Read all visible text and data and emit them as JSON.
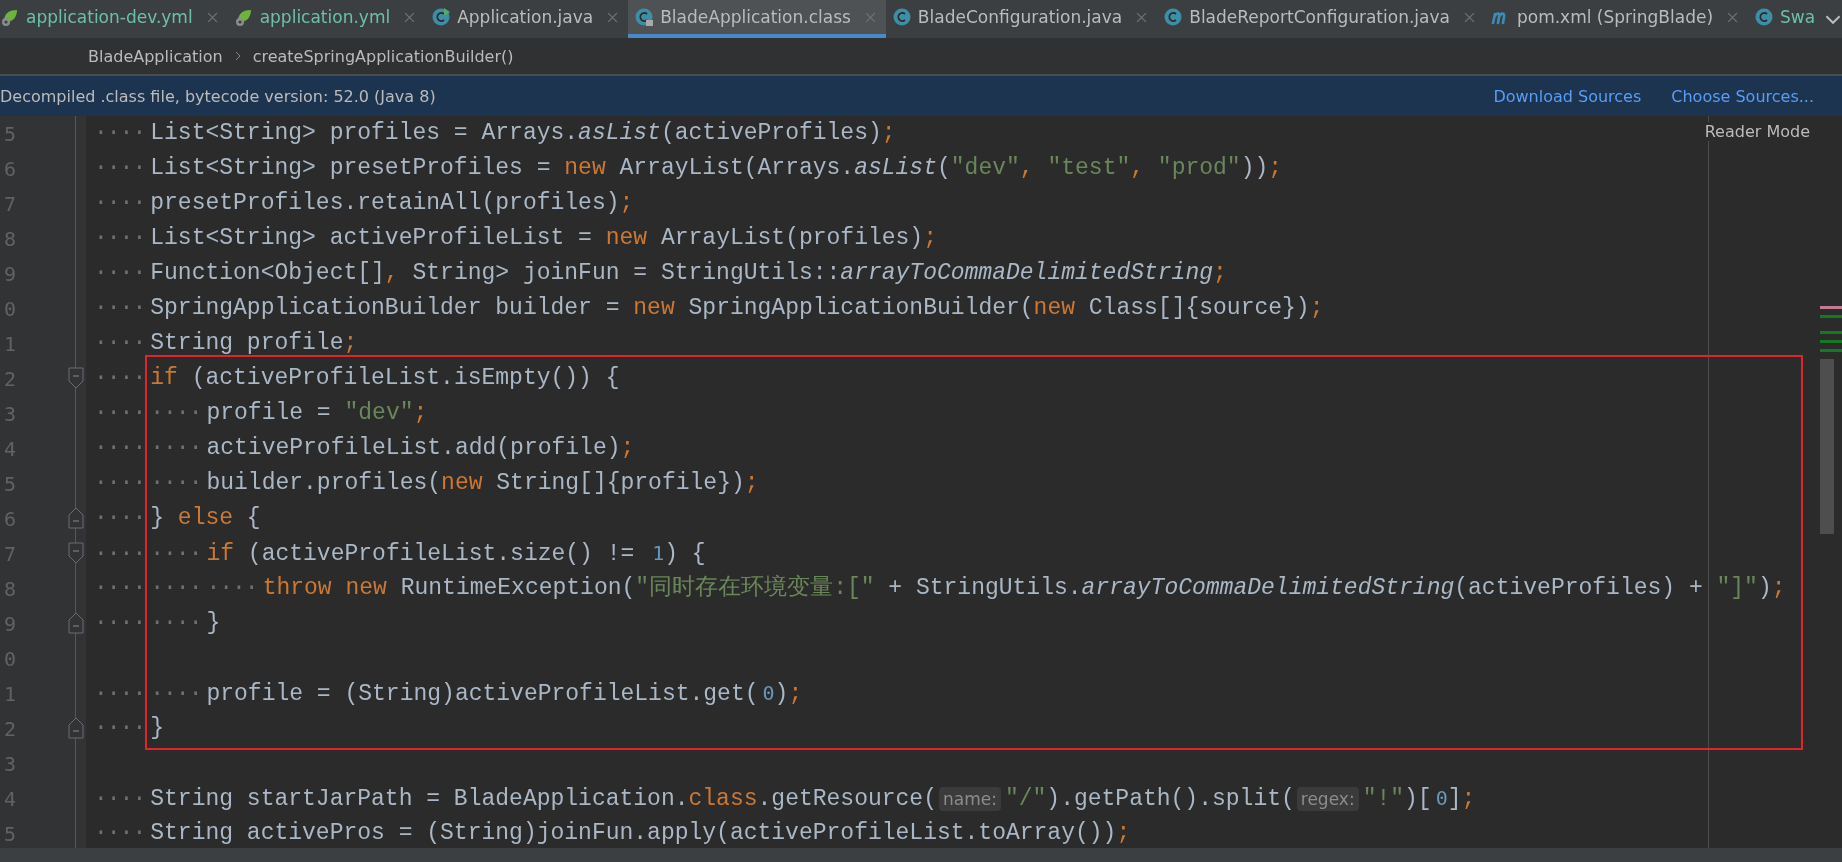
{
  "tabs": [
    {
      "label": "application-dev.yml",
      "kind": "spring",
      "color": "#6cc0a8",
      "selected": false
    },
    {
      "label": "application.yml",
      "kind": "spring",
      "color": "#6cc0a8",
      "selected": false
    },
    {
      "label": "Application.java",
      "kind": "class-run",
      "color": "#bbbbbb",
      "selected": false
    },
    {
      "label": "BladeApplication.class",
      "kind": "class-locked",
      "color": "#bbbbbb",
      "selected": true
    },
    {
      "label": "BladeConfiguration.java",
      "kind": "class",
      "color": "#bbbbbb",
      "selected": false
    },
    {
      "label": "BladeReportConfiguration.java",
      "kind": "class",
      "color": "#bbbbbb",
      "selected": false
    },
    {
      "label": "pom.xml (SpringBlade)",
      "kind": "maven",
      "color": "#bbbbbb",
      "selected": false
    },
    {
      "label": "Swa",
      "kind": "class",
      "color": "#6cc0a8",
      "selected": false,
      "cut": true
    }
  ],
  "breadcrumbs": [
    "BladeApplication",
    "createSpringApplicationBuilder()"
  ],
  "banner": {
    "message": "Decompiled .class file, bytecode version: 52.0 (Java 8)",
    "links": [
      "Download Sources",
      "Choose Sources..."
    ]
  },
  "reader_mode": "Reader Mode",
  "code_blocks": [
    {
      "framed": false,
      "lines": [
        {
          "number": "5",
          "tokens": [
            {
              "kind": "ws",
              "text": "····"
            },
            {
              "kind": "plain",
              "text": "List<String> profiles = Arrays."
            },
            {
              "kind": "italic",
              "text": "asList"
            },
            {
              "kind": "plain",
              "text": "(activeProfiles)"
            },
            {
              "kind": "kw",
              "text": ";"
            }
          ]
        },
        {
          "number": "6",
          "tokens": [
            {
              "kind": "ws",
              "text": "····"
            },
            {
              "kind": "plain",
              "text": "List<String> presetProfiles = "
            },
            {
              "kind": "kw",
              "text": "new "
            },
            {
              "kind": "plain",
              "text": "ArrayList(Arrays."
            },
            {
              "kind": "italic",
              "text": "asList"
            },
            {
              "kind": "plain",
              "text": "("
            },
            {
              "kind": "str",
              "text": "\"dev\""
            },
            {
              "kind": "kw",
              "text": ", "
            },
            {
              "kind": "str",
              "text": "\"test\""
            },
            {
              "kind": "kw",
              "text": ", "
            },
            {
              "kind": "str",
              "text": "\"prod\""
            },
            {
              "kind": "plain",
              "text": "))"
            },
            {
              "kind": "kw",
              "text": ";"
            }
          ]
        },
        {
          "number": "7",
          "tokens": [
            {
              "kind": "ws",
              "text": "····"
            },
            {
              "kind": "plain",
              "text": "presetProfiles.retainAll(profiles)"
            },
            {
              "kind": "kw",
              "text": ";"
            }
          ]
        },
        {
          "number": "8",
          "tokens": [
            {
              "kind": "ws",
              "text": "····"
            },
            {
              "kind": "plain",
              "text": "List<String> activeProfileList = "
            },
            {
              "kind": "kw",
              "text": "new "
            },
            {
              "kind": "plain",
              "text": "ArrayList(profiles)"
            },
            {
              "kind": "kw",
              "text": ";"
            }
          ]
        },
        {
          "number": "9",
          "tokens": [
            {
              "kind": "ws",
              "text": "····"
            },
            {
              "kind": "plain",
              "text": "Function<Object[]"
            },
            {
              "kind": "kw",
              "text": ", "
            },
            {
              "kind": "plain",
              "text": "String> joinFun = StringUtils::"
            },
            {
              "kind": "italic",
              "text": "arrayToCommaDelimitedString"
            },
            {
              "kind": "kw",
              "text": ";"
            }
          ]
        },
        {
          "number": "0",
          "tokens": [
            {
              "kind": "ws",
              "text": "····"
            },
            {
              "kind": "plain",
              "text": "SpringApplicationBuilder builder = "
            },
            {
              "kind": "kw",
              "text": "new "
            },
            {
              "kind": "plain",
              "text": "SpringApplicationBuilder("
            },
            {
              "kind": "kw",
              "text": "new "
            },
            {
              "kind": "plain",
              "text": "Class[]{source})"
            },
            {
              "kind": "kw",
              "text": ";"
            }
          ]
        },
        {
          "number": "1",
          "tokens": [
            {
              "kind": "ws",
              "text": "····"
            },
            {
              "kind": "plain",
              "text": "String profile"
            },
            {
              "kind": "kw",
              "text": ";"
            }
          ]
        }
      ]
    },
    {
      "framed": true,
      "lines": [
        {
          "number": "2",
          "kind": "fold-start",
          "tokens": [
            {
              "kind": "ws",
              "text": "····"
            },
            {
              "kind": "kw",
              "text": "if "
            },
            {
              "kind": "plain",
              "text": "(activeProfileList.isEmpty()) {"
            }
          ]
        },
        {
          "number": "3",
          "tokens": [
            {
              "kind": "ws",
              "text": "····"
            },
            {
              "kind": "ws",
              "text": "····"
            },
            {
              "kind": "plain",
              "text": "profile = "
            },
            {
              "kind": "str",
              "text": "\"dev\""
            },
            {
              "kind": "kw",
              "text": ";"
            }
          ]
        },
        {
          "number": "4",
          "tokens": [
            {
              "kind": "ws",
              "text": "····"
            },
            {
              "kind": "ws",
              "text": "····"
            },
            {
              "kind": "plain",
              "text": "activeProfileList.add(profile)"
            },
            {
              "kind": "kw",
              "text": ";"
            }
          ]
        },
        {
          "number": "5",
          "tokens": [
            {
              "kind": "ws",
              "text": "····"
            },
            {
              "kind": "ws",
              "text": "····"
            },
            {
              "kind": "plain",
              "text": "builder.profiles("
            },
            {
              "kind": "kw",
              "text": "new "
            },
            {
              "kind": "plain",
              "text": "String[]{profile})"
            },
            {
              "kind": "kw",
              "text": ";"
            }
          ]
        },
        {
          "number": "6",
          "kind": "fold-end",
          "tokens": [
            {
              "kind": "ws",
              "text": "····"
            },
            {
              "kind": "plain",
              "text": "} "
            },
            {
              "kind": "kw",
              "text": "else "
            },
            {
              "kind": "plain",
              "text": "{"
            }
          ]
        },
        {
          "number": "7",
          "kind": "fold-start",
          "tokens": [
            {
              "kind": "ws",
              "text": "····"
            },
            {
              "kind": "ws",
              "text": "····"
            },
            {
              "kind": "kw",
              "text": "if "
            },
            {
              "kind": "plain",
              "text": "(activeProfileList.size() != "
            },
            {
              "kind": "num",
              "text": "1"
            },
            {
              "kind": "plain",
              "text": ") {"
            }
          ]
        },
        {
          "number": "8",
          "tokens": [
            {
              "kind": "ws",
              "text": "····"
            },
            {
              "kind": "ws",
              "text": "····"
            },
            {
              "kind": "ws",
              "text": "····"
            },
            {
              "kind": "kw",
              "text": "throw new "
            },
            {
              "kind": "plain",
              "text": "RuntimeException("
            },
            {
              "kind": "str",
              "text": "\"同时存在环境变量:[\""
            },
            {
              "kind": "plain",
              "text": " + StringUtils."
            },
            {
              "kind": "italic",
              "text": "arrayToCommaDelimitedString"
            },
            {
              "kind": "plain",
              "text": "(activeProfiles) + "
            },
            {
              "kind": "str",
              "text": "\"]\""
            },
            {
              "kind": "plain",
              "text": ")"
            },
            {
              "kind": "kw",
              "text": ";"
            }
          ]
        },
        {
          "number": "9",
          "kind": "fold-end",
          "tokens": [
            {
              "kind": "ws",
              "text": "····"
            },
            {
              "kind": "ws",
              "text": "····"
            },
            {
              "kind": "plain",
              "text": "}"
            }
          ]
        },
        {
          "number": "0"
        },
        {
          "number": "1",
          "tokens": [
            {
              "kind": "ws",
              "text": "····"
            },
            {
              "kind": "ws",
              "text": "····"
            },
            {
              "kind": "plain",
              "text": "profile = (String)activeProfileList.get("
            },
            {
              "kind": "num",
              "text": "0"
            },
            {
              "kind": "plain",
              "text": ")"
            },
            {
              "kind": "kw",
              "text": ";"
            }
          ]
        },
        {
          "number": "2",
          "kind": "fold-end",
          "tokens": [
            {
              "kind": "ws",
              "text": "····"
            },
            {
              "kind": "plain",
              "text": "}"
            }
          ]
        }
      ]
    },
    {
      "framed": false,
      "lines": [
        {
          "number": "3"
        },
        {
          "number": "4",
          "tokens": [
            {
              "kind": "ws",
              "text": "····"
            },
            {
              "kind": "plain",
              "text": "String startJarPath = BladeApplication."
            },
            {
              "kind": "kw",
              "text": "class"
            },
            {
              "kind": "plain",
              "text": ".getResource("
            },
            {
              "kind": "hint",
              "text": "name:"
            },
            {
              "kind": "str",
              "text": "\"/\""
            },
            {
              "kind": "plain",
              "text": ").getPath().split("
            },
            {
              "kind": "hint",
              "text": "regex:"
            },
            {
              "kind": "str",
              "text": "\"!\""
            },
            {
              "kind": "plain",
              "text": ")["
            },
            {
              "kind": "num",
              "text": "0"
            },
            {
              "kind": "plain",
              "text": "]"
            },
            {
              "kind": "kw",
              "text": ";"
            }
          ]
        },
        {
          "number": "5",
          "tokens": [
            {
              "kind": "ws",
              "text": "····"
            },
            {
              "kind": "plain",
              "text": "String activePros = (String)joinFun.apply(activeProfileList.toArray())"
            },
            {
              "kind": "kw",
              "text": ";"
            }
          ]
        }
      ]
    }
  ]
}
